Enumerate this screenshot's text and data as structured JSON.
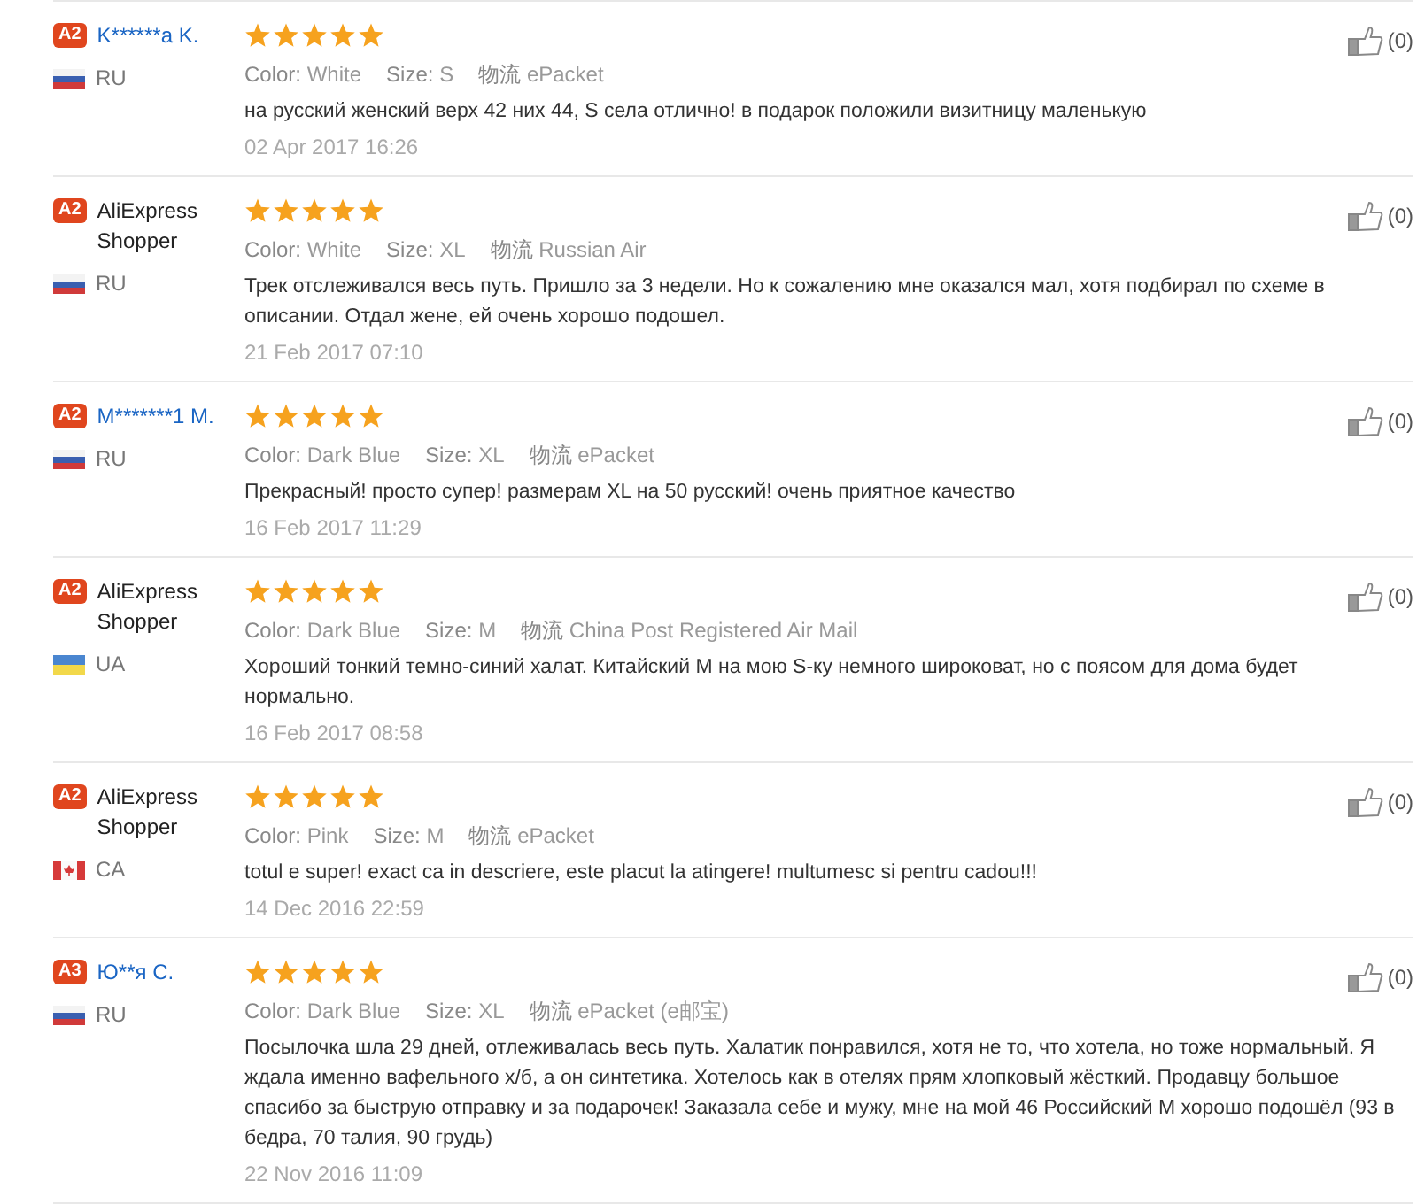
{
  "reviews": [
    {
      "badge": "A2",
      "name": "K******а K.",
      "linked": true,
      "flag": {
        "kind": "ru"
      },
      "country": "RU",
      "stars": 5,
      "attributes": [
        {
          "label": "Color:",
          "value": "White"
        },
        {
          "label": "Size:",
          "value": "S"
        },
        {
          "label": "物流",
          "value": "ePacket"
        }
      ],
      "text": "на русский женский верх 42 них 44, S села отлично! в подарок положили визитницу маленькую",
      "date": "02 Apr 2017 16:26",
      "likes": "(0)"
    },
    {
      "badge": "A2",
      "name": "AliExpress Shopper",
      "linked": false,
      "flag": {
        "kind": "ru"
      },
      "country": "RU",
      "stars": 5,
      "attributes": [
        {
          "label": "Color:",
          "value": "White"
        },
        {
          "label": "Size:",
          "value": "XL"
        },
        {
          "label": "物流",
          "value": "Russian Air"
        }
      ],
      "text": "Трек отслеживался весь путь. Пришло за 3 недели. Но к сожалению мне оказался мал, хотя подбирал по схеме в описании. Отдал жене, ей очень хорошо подошел.",
      "date": "21 Feb 2017 07:10",
      "likes": "(0)"
    },
    {
      "badge": "A2",
      "name": "M*******1 M.",
      "linked": true,
      "flag": {
        "kind": "ru"
      },
      "country": "RU",
      "stars": 5,
      "attributes": [
        {
          "label": "Color:",
          "value": "Dark Blue"
        },
        {
          "label": "Size:",
          "value": "XL"
        },
        {
          "label": "物流",
          "value": "ePacket"
        }
      ],
      "text": "Прекрасный! просто супер! размерам XL на 50 русский! очень приятное качество",
      "date": "16 Feb 2017 11:29",
      "likes": "(0)"
    },
    {
      "badge": "A2",
      "name": "AliExpress Shopper",
      "linked": false,
      "flag": {
        "kind": "ua"
      },
      "country": "UA",
      "stars": 5,
      "attributes": [
        {
          "label": "Color:",
          "value": "Dark Blue"
        },
        {
          "label": "Size:",
          "value": "M"
        },
        {
          "label": "物流",
          "value": "China Post Registered Air Mail"
        }
      ],
      "text": "Хороший тонкий темно-синий халат. Китайский M на мою S-ку немного широковат, но с поясом для дома будет нормально.",
      "date": "16 Feb 2017 08:58",
      "likes": "(0)"
    },
    {
      "badge": "A2",
      "name": "AliExpress Shopper",
      "linked": false,
      "flag": {
        "kind": "ca"
      },
      "country": "CA",
      "stars": 5,
      "attributes": [
        {
          "label": "Color:",
          "value": "Pink"
        },
        {
          "label": "Size:",
          "value": "M"
        },
        {
          "label": "物流",
          "value": "ePacket"
        }
      ],
      "text": "totul e super! exact ca in descriere, este placut la atingere! multumesc si pentru cadou!!!",
      "date": "14 Dec 2016 22:59",
      "likes": "(0)"
    },
    {
      "badge": "A3",
      "name": "Ю**я С.",
      "linked": true,
      "flag": {
        "kind": "ru"
      },
      "country": "RU",
      "stars": 5,
      "attributes": [
        {
          "label": "Color:",
          "value": "Dark Blue"
        },
        {
          "label": "Size:",
          "value": "XL"
        },
        {
          "label": "物流",
          "value": "ePacket (e邮宝)"
        }
      ],
      "text": "Посылочка шла 29 дней, отлеживалась весь путь. Халатик понравился, хотя не то, что хотела, но тоже нормальный. Я ждала именно вафельного х/б, а он синтетика. Хотелось как в отелях прям хлопковый жёсткий. Продавцу большое спасибо за быструю отправку и за подарочек! Заказала себе и мужу, мне на мой 46 Российский М хорошо подошёл (93 в бедра, 70 талия, 90 грудь)",
      "date": "22 Nov 2016 11:09",
      "likes": "(0)"
    }
  ]
}
